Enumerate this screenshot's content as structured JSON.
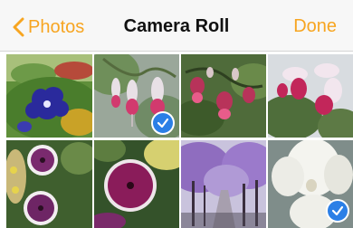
{
  "nav": {
    "back_label": "Photos",
    "title": "Camera Roll",
    "done_label": "Done"
  },
  "colors": {
    "accent": "#f7a521",
    "selection_badge": "#2b7fe6"
  },
  "photos": [
    {
      "subject": "blue flowers on grass",
      "selected": false
    },
    {
      "subject": "pink hanging fuchsia flowers",
      "selected": true
    },
    {
      "subject": "fuchsia flowers with buds",
      "selected": false
    },
    {
      "subject": "fuchsia blossoms close-up",
      "selected": false
    },
    {
      "subject": "purple petunias",
      "selected": false
    },
    {
      "subject": "magenta petunia",
      "selected": false
    },
    {
      "subject": "purple blossom trees along path",
      "selected": false
    },
    {
      "subject": "white orchid",
      "selected": true
    }
  ]
}
